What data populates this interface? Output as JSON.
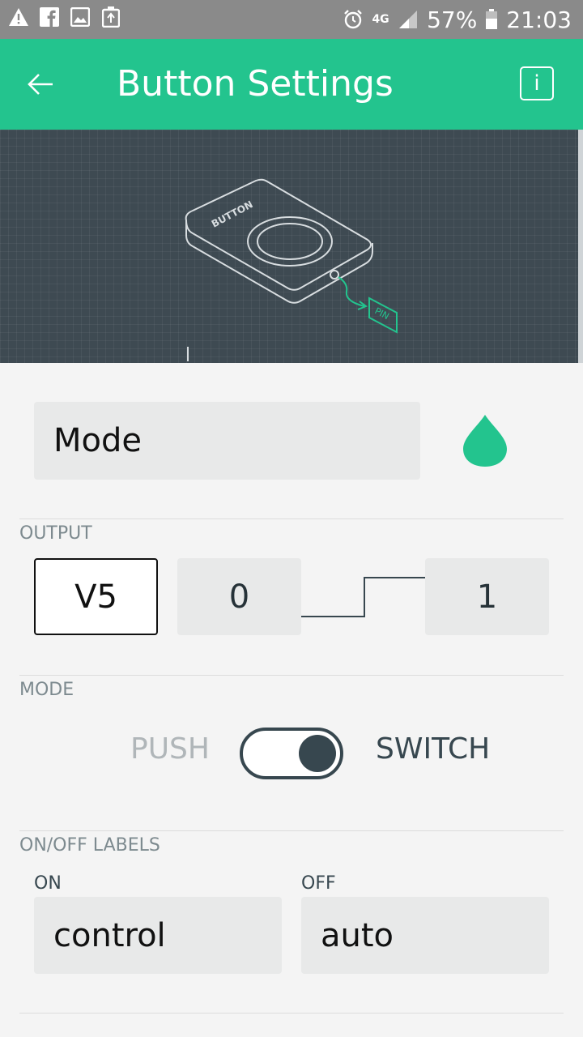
{
  "status_bar": {
    "icons": [
      "warning-icon",
      "facebook-icon",
      "image-icon",
      "recycle-icon",
      "alarm-icon",
      "network-4g-icon",
      "signal-icon",
      "battery-icon"
    ],
    "network": "4G",
    "battery": "57%",
    "time": "21:03"
  },
  "app_bar": {
    "title": "Button Settings",
    "info_label": "i",
    "color": "#23c48e"
  },
  "preview": {
    "widget_label": "BUTTON",
    "pin_label": "PIN"
  },
  "name_field": {
    "value": "Mode",
    "color_swatch": "#23c48e"
  },
  "output": {
    "section_label": "OUTPUT",
    "pin": "V5",
    "min": "0",
    "max": "1"
  },
  "mode": {
    "section_label": "MODE",
    "option_push": "PUSH",
    "option_switch": "SWITCH",
    "selected": "SWITCH"
  },
  "labels": {
    "section_label": "ON/OFF LABELS",
    "on_label": "ON",
    "on_value": "control",
    "off_label": "OFF",
    "off_value": "auto"
  }
}
